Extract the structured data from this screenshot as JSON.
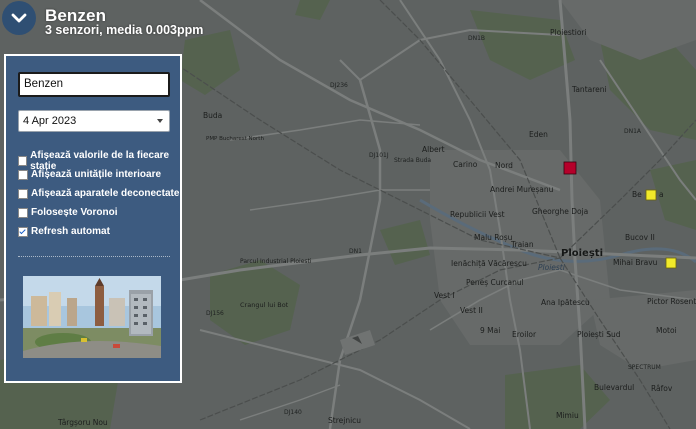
{
  "header": {
    "title": "Benzen",
    "subtitle": "3 senzori, media 0.003ppm"
  },
  "panel": {
    "pollutant_input": {
      "value": "Benzen"
    },
    "date_select": {
      "selected": "4 Apr 2023"
    },
    "options": [
      {
        "label": "Afișează valorile de la fiecare stație",
        "checked": false
      },
      {
        "label": "Afișează unitățile interioare",
        "checked": false
      },
      {
        "label": "Afișează aparatele deconectate",
        "checked": false
      },
      {
        "label": "Folosește Voronoi",
        "checked": false
      },
      {
        "label": "Refresh automat",
        "checked": true
      }
    ]
  },
  "map": {
    "labels": {
      "ploiesti": "Ploiești",
      "ploiesti_river": "Ploiesti",
      "albert": "Albert",
      "carino": "Carino",
      "nord": "Nord",
      "eden": "Eden",
      "andrei_muresanu": "Andrei Mureșanu",
      "republicii_vest": "Republicii Vest",
      "gheorghe_doja": "Gheorghe Doja",
      "malu_rosu": "Malu Roșu",
      "traian": "Traian",
      "ienachita": "Ienăchiță Văcărescu",
      "penes_curcanul": "Peneș Curcanul",
      "vest_i": "Vest I",
      "vest_ii": "Vest II",
      "noua_mai": "9 Mai",
      "eroilor": "Eroilor",
      "ana_ipatescu": "Ana Ipătescu",
      "ploiesti_sud": "Ploiești Sud",
      "mihai_bravu": "Mihai Bravu",
      "bucov_ii": "Bucov II",
      "pictor_rosenthal": "Pictor Rosenth",
      "motoi": "Motoi",
      "bulevardul": "Bulevardul",
      "rafov": "Râfov",
      "mimiu": "Mimiu",
      "tantareni": "Tantareni",
      "ploiestiori": "Ploiestiori",
      "targsoru_nou": "Târgșoru Nou",
      "strejnicu": "Strejnicu",
      "buda": "Buda",
      "parcul": "Parcul Industrial Ploiesti",
      "crangul": "Crangul lui Bot",
      "benzina": "Be",
      "ben_suffix": "a",
      "pmp": "PMP Bucharest North",
      "dn1": "DN1",
      "dn1b": "DN1B",
      "dn1a": "DN1A",
      "dj236": "DJ236",
      "dj101j": "DJ101J",
      "dj156": "DJ156",
      "dj140": "DJ140",
      "strada_buda": "Strada Buda",
      "spectrum": "SPECTRUM"
    },
    "sensor_colors": {
      "red": "#b5002a",
      "yellow": "#f1ea2a"
    }
  }
}
